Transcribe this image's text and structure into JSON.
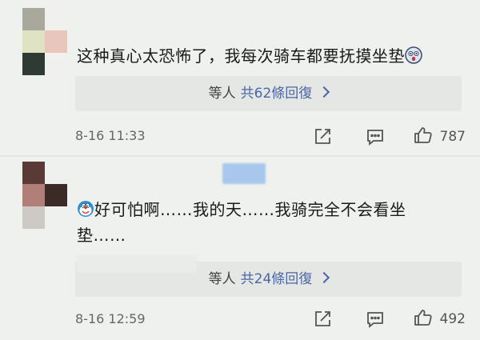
{
  "comments": [
    {
      "text": "这种真心太恐怖了，我每次骑车都要抚摸坐垫",
      "replies_prefix": "等人",
      "replies_count": "共62條回復",
      "time": "8-16 11:33",
      "likes": "787"
    },
    {
      "text": "好可怕啊……我的天……我骑完全不会看坐垫……",
      "replies_prefix": "等人",
      "replies_count": "共24條回復",
      "time": "8-16 12:59",
      "likes": "492"
    }
  ],
  "icons": {
    "emoji_1": "surprised-face-icon",
    "emoji_2": "doraemon-face-icon",
    "share": "share-icon",
    "comment": "comment-icon",
    "like": "thumbs-up-icon"
  },
  "colors": {
    "link": "#4b66a8",
    "background": "#eef1ee",
    "reply_box": "#e4e7e4"
  }
}
